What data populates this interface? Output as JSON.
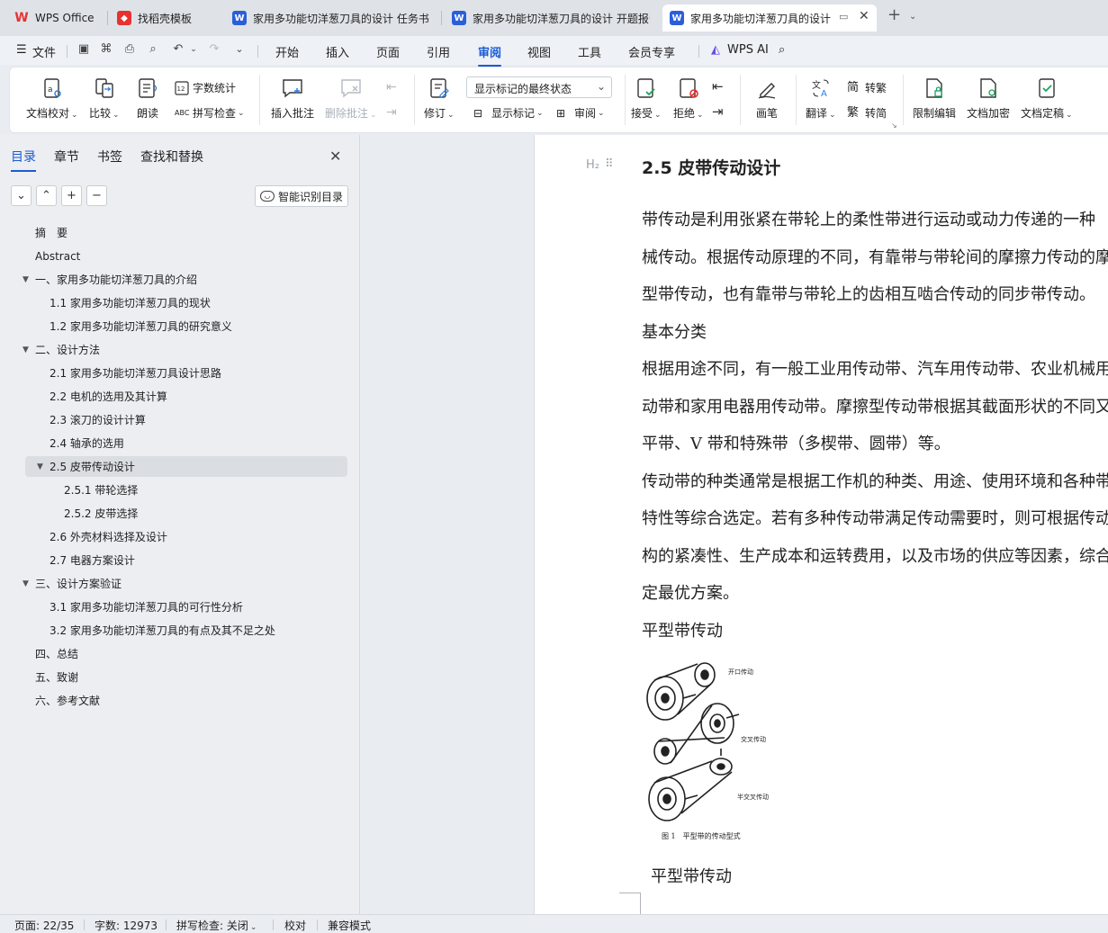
{
  "tabs": [
    {
      "label": "WPS Office",
      "icon": "wps-logo-icon",
      "color": "#e8322f",
      "glyph": "W"
    },
    {
      "label": "找稻壳模板",
      "icon": "docer-icon",
      "color": "#e8322f",
      "glyph": "◆"
    },
    {
      "label": "家用多功能切洋葱刀具的设计 任务书",
      "icon": "word-doc-icon",
      "color": "#2b5fd9",
      "glyph": "W"
    },
    {
      "label": "家用多功能切洋葱刀具的设计 开题报告",
      "icon": "word-doc-icon",
      "color": "#2b5fd9",
      "glyph": "W"
    },
    {
      "label": "家用多功能切洋葱刀具的设计",
      "icon": "word-doc-icon",
      "color": "#2b5fd9",
      "glyph": "W",
      "active": true
    }
  ],
  "menu": {
    "file": "文件",
    "items": [
      "开始",
      "插入",
      "页面",
      "引用",
      "审阅",
      "视图",
      "工具",
      "会员专享"
    ],
    "active": "审阅",
    "ai": "WPS AI"
  },
  "ribbon": {
    "doc_proofread": "文档校对",
    "compare": "比较",
    "read_aloud": "朗读",
    "word_count": "字数统计",
    "spell_check": "拼写检查",
    "insert_comment": "插入批注",
    "delete_comment": "删除批注",
    "revise": "修订",
    "markup_state": "显示标记的最终状态",
    "show_markup": "显示标记",
    "review": "审阅",
    "accept": "接受",
    "reject": "拒绝",
    "pen": "画笔",
    "translate": "翻译",
    "to_traditional": "转繁",
    "to_simplified": "转简",
    "restrict_edit": "限制编辑",
    "encrypt": "文档加密",
    "finalize": "文档定稿"
  },
  "nav": {
    "tabs": [
      "目录",
      "章节",
      "书签",
      "查找和替换"
    ],
    "smart_toc": "智能识别目录",
    "toc": [
      {
        "label": "摘　要",
        "level": 0
      },
      {
        "label": "Abstract",
        "level": 0
      },
      {
        "label": "一、家用多功能切洋葱刀具的介绍",
        "level": 0,
        "expanded": true
      },
      {
        "label": "1.1 家用多功能切洋葱刀具的现状",
        "level": 1
      },
      {
        "label": "1.2 家用多功能切洋葱刀具的研究意义",
        "level": 1
      },
      {
        "label": "二、设计方法",
        "level": 0,
        "expanded": true
      },
      {
        "label": "2.1 家用多功能切洋葱刀具设计思路",
        "level": 1
      },
      {
        "label": "2.2 电机的选用及其计算",
        "level": 1
      },
      {
        "label": "2.3 滚刀的设计计算",
        "level": 1
      },
      {
        "label": "2.4 轴承的选用",
        "level": 1
      },
      {
        "label": "2.5 皮带传动设计",
        "level": 1,
        "expanded": true,
        "selected": true
      },
      {
        "label": "2.5.1 带轮选择",
        "level": 2
      },
      {
        "label": "2.5.2 皮带选择",
        "level": 2
      },
      {
        "label": "2.6 外壳材料选择及设计",
        "level": 1
      },
      {
        "label": "2.7 电器方案设计",
        "level": 1
      },
      {
        "label": "三、设计方案验证",
        "level": 0,
        "expanded": true
      },
      {
        "label": "3.1 家用多功能切洋葱刀具的可行性分析",
        "level": 1
      },
      {
        "label": "3.2 家用多功能切洋葱刀具的有点及其不足之处",
        "level": 1
      },
      {
        "label": "四、总结",
        "level": 0
      },
      {
        "label": "五、致谢",
        "level": 0
      },
      {
        "label": "六、参考文献",
        "level": 0
      }
    ]
  },
  "doc": {
    "heading_marker": "H₂",
    "heading": "2.5 皮带传动设计",
    "paragraphs": [
      "带传动是利用张紧在带轮上的柔性带进行运动或动力传递的一种",
      "械传动。根据传动原理的不同，有靠带与带轮间的摩擦力传动的摩",
      "型带传动，也有靠带与带轮上的齿相互啮合传动的同步带传动。",
      "基本分类",
      "根据用途不同，有一般工业用传动带、汽车用传动带、农业机械用",
      "动带和家用电器用传动带。摩擦型传动带根据其截面形状的不同又",
      "平带、V 带和特殊带（多楔带、圆带）等。",
      "传动带的种类通常是根据工作机的种类、用途、使用环境和各种带",
      "特性等综合选定。若有多种传动带满足传动需要时，则可根据传动",
      "构的紧凑性、生产成本和运转费用，以及市场的供应等因素，综合",
      "定最优方案。",
      "平型带传动"
    ],
    "figure_labels": [
      "开口传动",
      "交叉传动",
      "半交叉传动"
    ],
    "figure_caption": "图 1　平型带的传动型式",
    "after_figure": "平型带传动"
  },
  "status": {
    "page": "页面: 22/35",
    "words": "字数: 12973",
    "spell": "拼写检查: 关闭",
    "proof": "校对",
    "compat": "兼容模式"
  }
}
